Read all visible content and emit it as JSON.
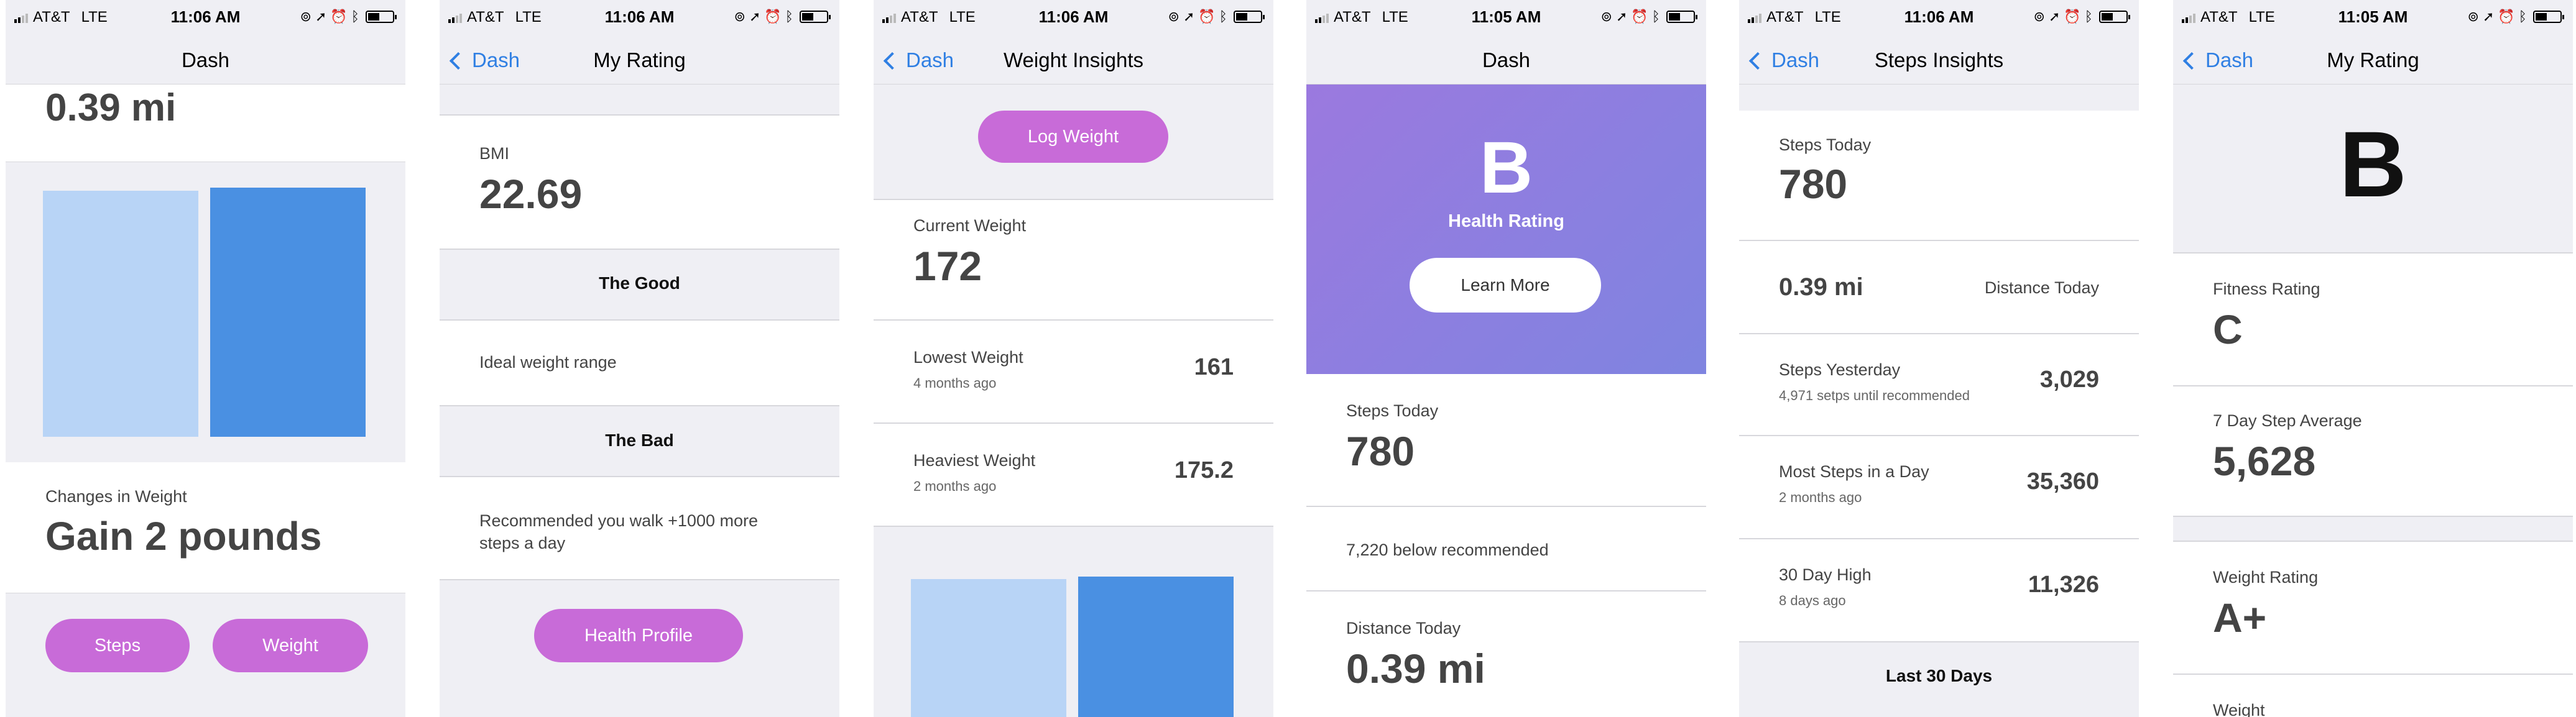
{
  "status": {
    "carrier": "AT&T",
    "network": "LTE"
  },
  "colors": {
    "accent": "#c86bd8",
    "link": "#2f7fe3",
    "bar_light": "#b8d4f6",
    "bar_dark": "#4a90e2",
    "hero_start": "#9b79df",
    "hero_end": "#7f84e0"
  },
  "screens": [
    {
      "time": "11:06 AM",
      "nav_title": "Dash",
      "distance": "0.39 mi",
      "changes_label": "Changes in Weight",
      "changes_value": "Gain 2 pounds",
      "steps_button": "Steps",
      "weight_button": "Weight"
    },
    {
      "time": "11:06 AM",
      "back": "Dash",
      "nav_title": "My Rating",
      "bmi_label": "BMI",
      "bmi_value": "22.69",
      "good_header": "The Good",
      "good_text": "Ideal weight range",
      "bad_header": "The Bad",
      "bad_text": "Recommended you walk +1000 more steps a day",
      "health_profile_button": "Health Profile"
    },
    {
      "time": "11:06 AM",
      "back": "Dash",
      "nav_title": "Weight Insights",
      "log_button": "Log Weight",
      "current_label": "Current Weight",
      "current_value": "172",
      "lowest_label": "Lowest Weight",
      "lowest_sub": "4 months ago",
      "lowest_value": "161",
      "heaviest_label": "Heaviest Weight",
      "heaviest_sub": "2 months ago",
      "heaviest_value": "175.2"
    },
    {
      "time": "11:05 AM",
      "nav_title": "Dash",
      "grade": "B",
      "grade_label": "Health Rating",
      "learn_more": "Learn More",
      "steps_label": "Steps Today",
      "steps_value": "780",
      "below_text": "7,220 below recommended",
      "distance_label": "Distance Today",
      "distance_value": "0.39 mi"
    },
    {
      "time": "11:06 AM",
      "back": "Dash",
      "nav_title": "Steps Insights",
      "steps_label": "Steps Today",
      "steps_value": "780",
      "distance_value": "0.39 mi",
      "distance_label": "Distance Today",
      "yesterday_label": "Steps Yesterday",
      "yesterday_sub": "4,971 setps until recommended",
      "yesterday_value": "3,029",
      "most_label": "Most Steps in a Day",
      "most_sub": "2 months ago",
      "most_value": "35,360",
      "high_label": "30 Day High",
      "high_sub": "8 days ago",
      "high_value": "11,326",
      "last30": "Last 30 Days"
    },
    {
      "time": "11:05 AM",
      "back": "Dash",
      "nav_title": "My Rating",
      "grade": "B",
      "fitness_label": "Fitness Rating",
      "fitness_value": "C",
      "avg_label": "7 Day Step Average",
      "avg_value": "5,628",
      "weight_rating_label": "Weight Rating",
      "weight_rating_value": "A+",
      "weight_partial": "Weight"
    }
  ]
}
